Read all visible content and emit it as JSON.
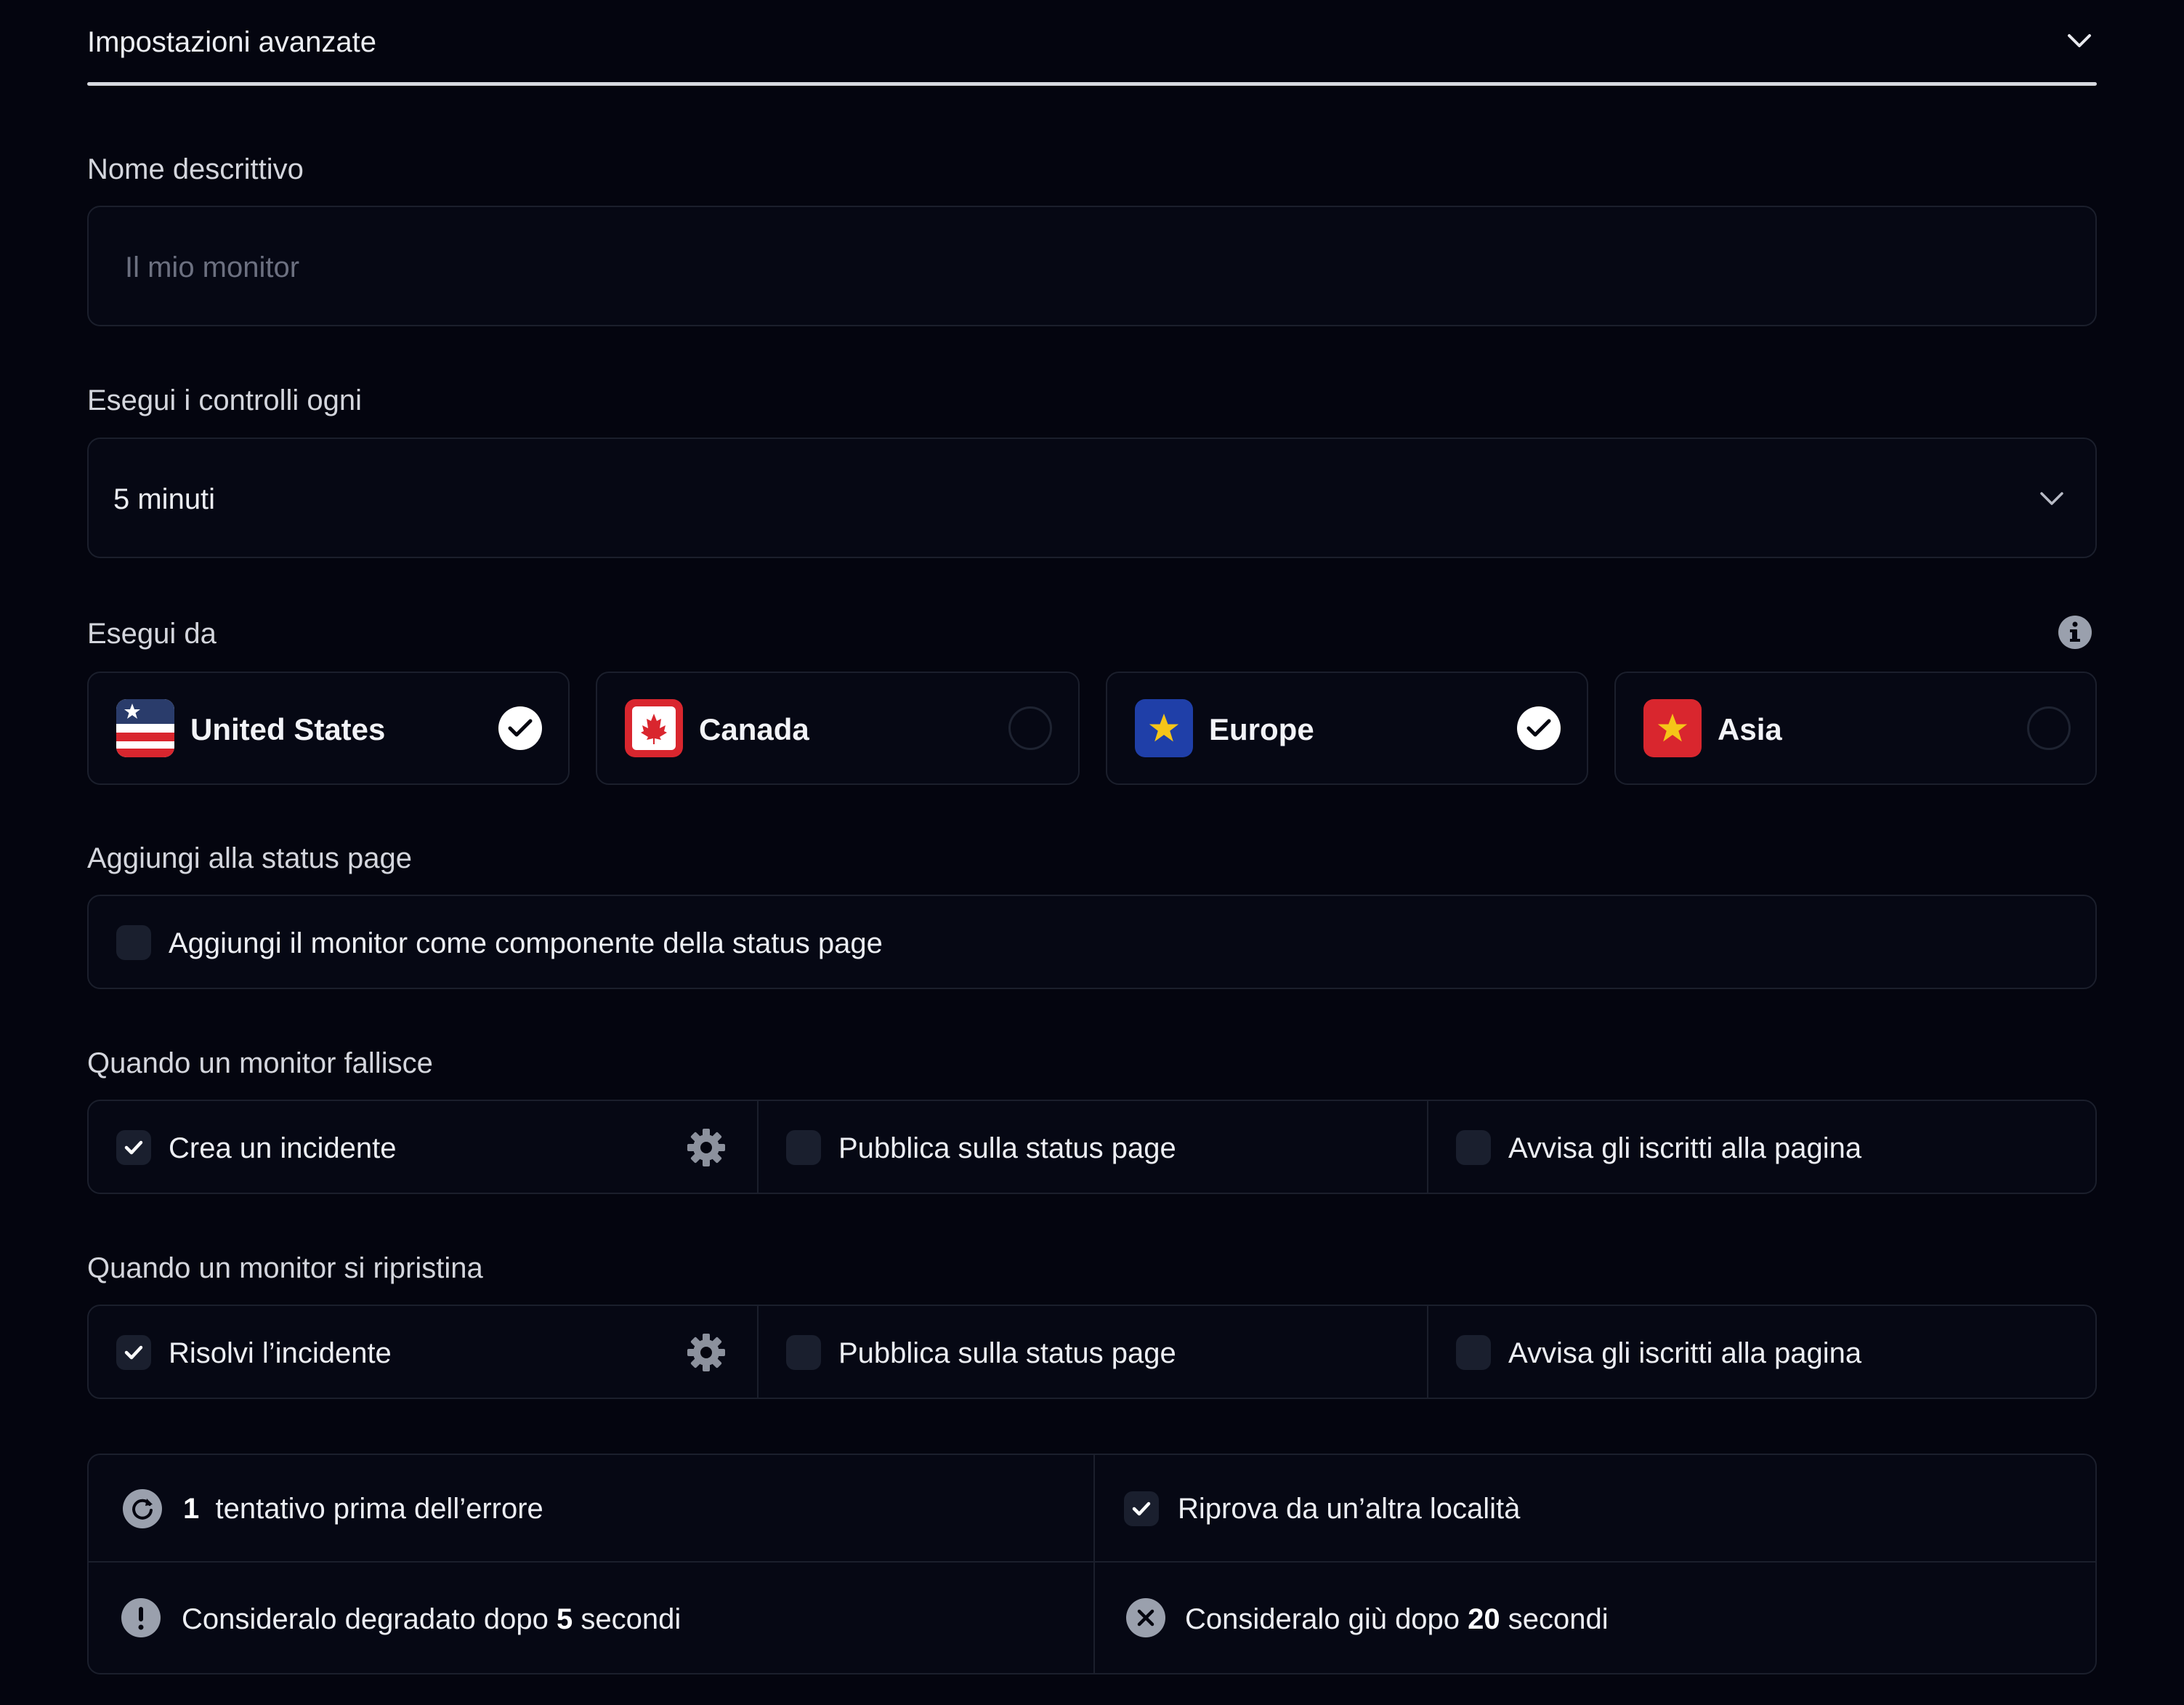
{
  "section": {
    "title": "Impostazioni avanzate"
  },
  "name_field": {
    "label": "Nome descrittivo",
    "placeholder": "Il mio monitor"
  },
  "interval": {
    "label": "Esegui i controlli ogni",
    "value": "5 minuti"
  },
  "regions": {
    "label": "Esegui da",
    "items": [
      {
        "name": "United States",
        "selected": true
      },
      {
        "name": "Canada",
        "selected": false
      },
      {
        "name": "Europe",
        "selected": true
      },
      {
        "name": "Asia",
        "selected": false
      }
    ]
  },
  "status_page": {
    "label": "Aggiungi alla status page",
    "option": "Aggiungi il monitor come componente della status page",
    "checked": false
  },
  "on_fail": {
    "label": "Quando un monitor fallisce",
    "options": [
      {
        "text": "Crea un incidente",
        "checked": true
      },
      {
        "text": "Pubblica sulla status page",
        "checked": false
      },
      {
        "text": "Avvisa gli iscritti alla pagina",
        "checked": false
      }
    ]
  },
  "on_recover": {
    "label": "Quando un monitor si ripristina",
    "options": [
      {
        "text": "Risolvi l’incidente",
        "checked": true
      },
      {
        "text": "Pubblica sulla status page",
        "checked": false
      },
      {
        "text": "Avvisa gli iscritti alla pagina",
        "checked": false
      }
    ]
  },
  "summary": {
    "retries_count": "1",
    "retries_text": "tentativo prima dell’errore",
    "retry_location": "Riprova da un’altra località",
    "degraded_pre": "Consideralo degradato dopo",
    "degraded_value": "5",
    "degraded_post": "secondi",
    "down_pre": "Consideralo giù dopo",
    "down_value": "20",
    "down_post": "secondi"
  },
  "colors": {
    "background": "#04050f",
    "border": "#1b1f2c",
    "accent_us": "#d9262e",
    "accent_eu": "#1f3fa8"
  }
}
